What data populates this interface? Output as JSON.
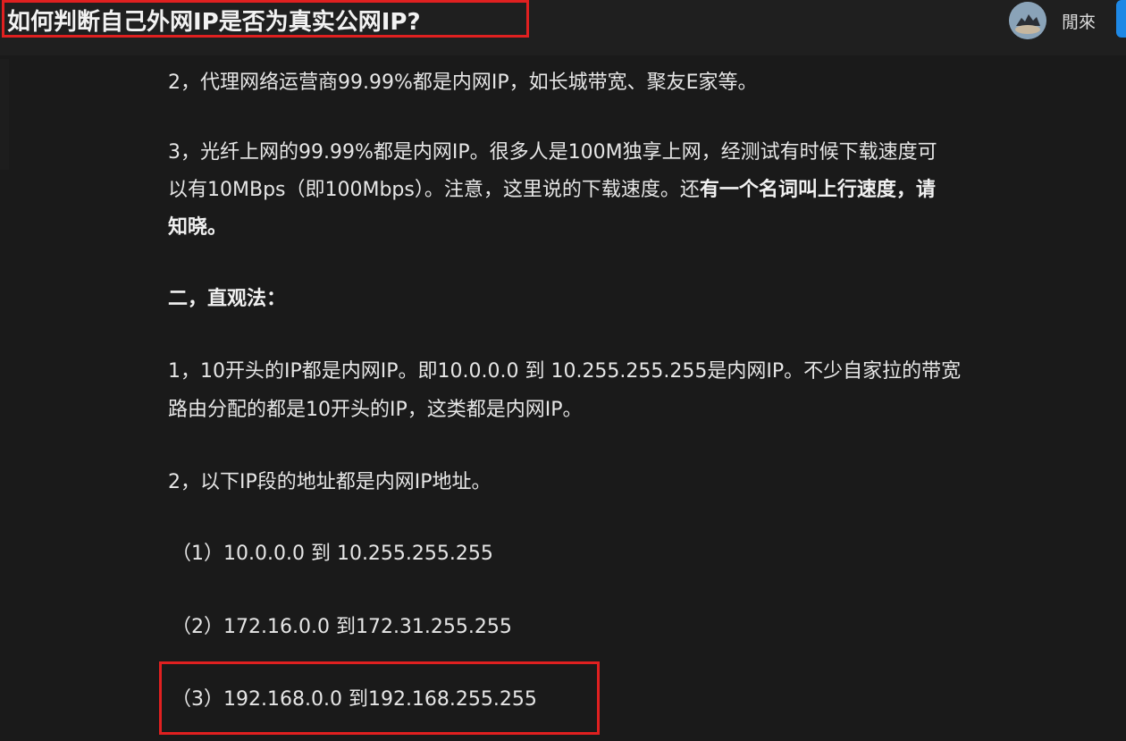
{
  "header": {
    "title": "如何判断自己外网IP是否为真实公网IP?",
    "username": "閒來",
    "avatar_icon": "user-avatar-icon",
    "accent_color": "#1e88e5",
    "highlight_color": "#e02020"
  },
  "article": {
    "p1": "2，代理网络运营商99.99%都是内网IP，如长城带宽、聚友E家等。",
    "p2_line1": "3，光纤上网的99.99%都是内网IP。很多人是100M独享上网，经测试有时候下载速度可",
    "p2_line2_normal": "以有10MBps（即100Mbps）。注意，这里说的下载速度。还",
    "p2_line2_bold": "有一个名词叫上行速度，请",
    "p2_line3_bold": "知晓。",
    "heading": "二，直观法：",
    "p3_line1": "1，10开头的IP都是内网IP。即10.0.0.0 到 10.255.255.255是内网IP。不少自家拉的带宽",
    "p3_line2": "路由分配的都是10开头的IP，这类都是内网IP。",
    "p4": "2，以下IP段的地址都是内网IP地址。",
    "ranges": [
      "（1）10.0.0.0 到 10.255.255.255",
      "（2）172.16.0.0 到172.31.255.255",
      "（3）192.168.0.0 到192.168.255.255"
    ]
  }
}
